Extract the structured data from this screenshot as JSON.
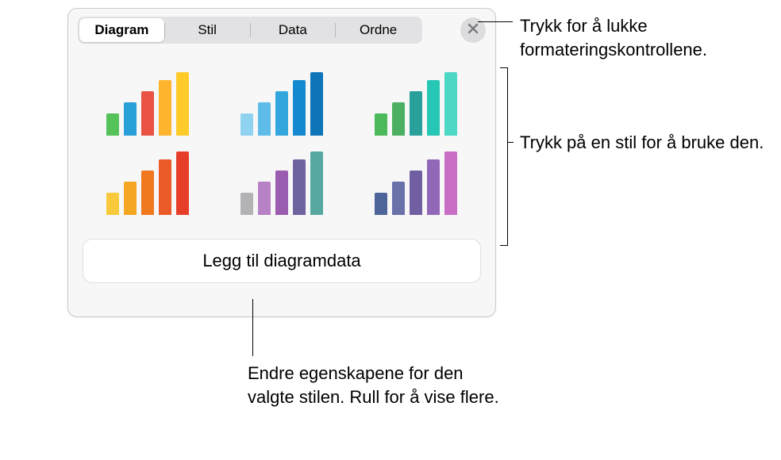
{
  "panel": {
    "tabs": {
      "diagram": "Diagram",
      "stil": "Stil",
      "data": "Data",
      "ordne": "Ordne"
    },
    "close_icon": "close",
    "bar_heights": [
      28,
      42,
      56,
      70,
      80
    ],
    "styles": [
      {
        "name": "style-1",
        "colors": [
          "#55c35a",
          "#2aa0d8",
          "#ea5244",
          "#ffb42e",
          "#ffcb2b"
        ]
      },
      {
        "name": "style-2",
        "colors": [
          "#8fd3f1",
          "#5fbce8",
          "#34a6de",
          "#1489cf",
          "#0f75b9"
        ]
      },
      {
        "name": "style-3",
        "colors": [
          "#4cba5a",
          "#4caf62",
          "#29a09a",
          "#27c7b5",
          "#4dd7c5"
        ]
      },
      {
        "name": "style-4",
        "colors": [
          "#f8c93a",
          "#f4a723",
          "#f0781e",
          "#eb5b28",
          "#e63e29"
        ]
      },
      {
        "name": "style-5",
        "colors": [
          "#b3b3b5",
          "#b782c5",
          "#9a5db0",
          "#70619f",
          "#56a8a1"
        ]
      },
      {
        "name": "style-6",
        "colors": [
          "#4d6598",
          "#6871a8",
          "#7160a1",
          "#9167b8",
          "#c86ec4"
        ]
      }
    ],
    "add_data_label": "Legg til diagramdata"
  },
  "callouts": {
    "close": "Trykk for å lukke formateringskontrollene.",
    "styles": "Trykk på en stil for å bruke den.",
    "bottom": "Endre egenskapene for den valgte stilen. Rull for å vise flere."
  }
}
